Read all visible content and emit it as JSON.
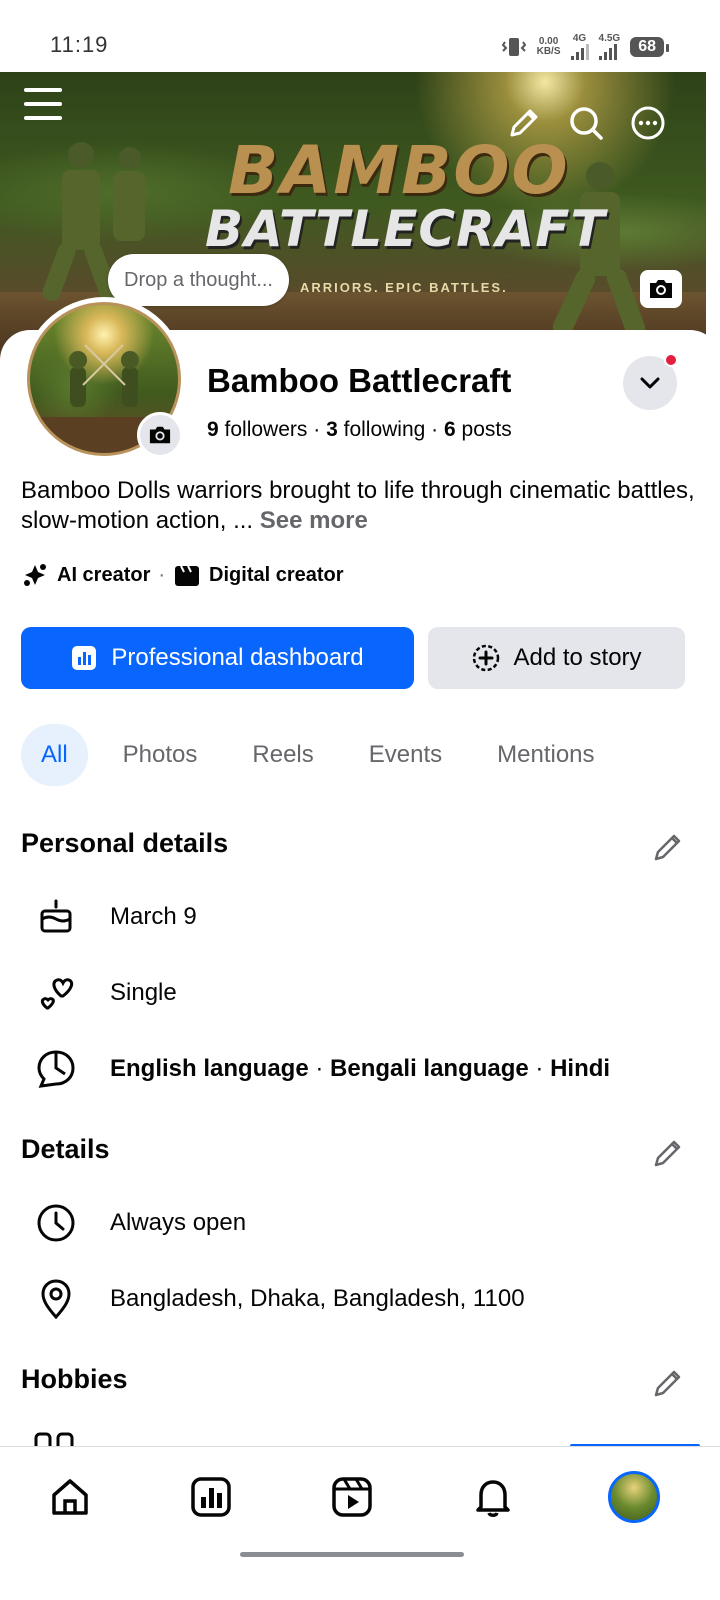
{
  "status_bar": {
    "time": "11:19",
    "net_speed_top": "0.00",
    "net_speed_bottom": "KB/S",
    "net1": "4G",
    "net2": "4.5G",
    "battery": "68"
  },
  "cover": {
    "title_line1": "BAMBOO",
    "title_line2": "BATTLECRAFT",
    "tagline": "ARRIORS. EPIC BATTLES.",
    "thought_placeholder": "Drop a thought..."
  },
  "profile": {
    "name": "Bamboo Battlecraft",
    "followers_count": "9",
    "followers_label": "followers",
    "following_count": "3",
    "following_label": "following",
    "posts_count": "6",
    "posts_label": "posts",
    "bio": "Bamboo Dolls warriors brought to life through cinematic battles, slow-motion action, ...",
    "see_more": "See more",
    "categories": [
      "AI creator",
      "Digital creator"
    ]
  },
  "actions": {
    "professional_dashboard": "Professional dashboard",
    "add_to_story": "Add to story"
  },
  "tabs": [
    "All",
    "Photos",
    "Reels",
    "Events",
    "Mentions"
  ],
  "personal_details": {
    "title": "Personal details",
    "birthday": "March 9",
    "relationship": "Single",
    "languages": [
      "English language",
      "Bengali language",
      "Hindi"
    ]
  },
  "details": {
    "title": "Details",
    "hours": "Always open",
    "location": "Bangladesh, Dhaka, Bangladesh, 1100"
  },
  "hobbies": {
    "title": "Hobbies"
  },
  "bottom_nav": [
    "home-icon",
    "dashboard-icon",
    "reels-icon",
    "notifications-icon",
    "profile-avatar"
  ],
  "colors": {
    "accent": "#0866ff",
    "secondary_button": "#e4e6eb",
    "notification_dot": "#e41e3f"
  }
}
